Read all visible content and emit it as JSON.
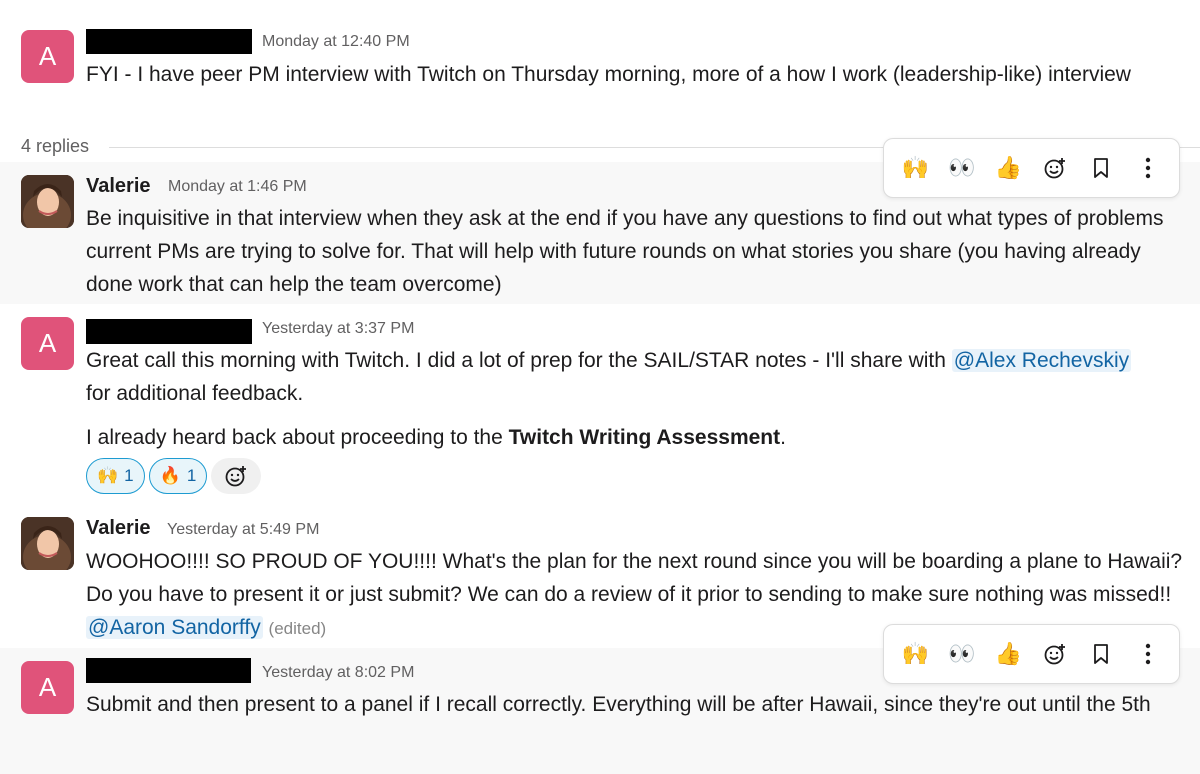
{
  "messages": [
    {
      "avatar_letter": "A",
      "timestamp": "Monday at 12:40 PM",
      "text": "FYI - I have peer PM interview with Twitch on Thursday morning, more of a how I work (leadership-like) interview"
    },
    {
      "author": "Valerie",
      "timestamp": "Monday at 1:46 PM",
      "text": "Be inquisitive in that interview when they ask at the end if you have any questions  to find out what types of problems current PMs are trying to solve for. That will help with future rounds on what stories you share (you having already done work that can help the team overcome)"
    },
    {
      "avatar_letter": "A",
      "timestamp": "Yesterday at 3:37 PM",
      "text_before_mention": "Great call this morning with Twitch. I did a lot of prep for the SAIL/STAR notes - I'll share with ",
      "mention": "@Alex Rechevskiy",
      "text_after_mention": "for additional feedback.",
      "para2_before": "I already heard back about proceeding to the ",
      "para2_bold": "Twitch Writing Assessment",
      "para2_after": ".",
      "reactions": [
        {
          "emoji": "🙌",
          "count": "1"
        },
        {
          "emoji": "🔥",
          "count": "1"
        }
      ]
    },
    {
      "author": "Valerie",
      "timestamp": "Yesterday at 5:49 PM",
      "text_before_mention": "WOOHOO!!!! SO PROUD OF YOU!!!! What's the plan for the next round since you will be boarding a plane to Hawaii? Do you have to present it or just submit? We can do a review of it prior to sending to make sure nothing was missed!! ",
      "mention": "@Aaron Sandorffy",
      "edited": "(edited)"
    },
    {
      "avatar_letter": "A",
      "timestamp": "Yesterday at 8:02 PM",
      "text": "Submit and then present to a panel if I recall correctly. Everything will be after Hawaii, since they're out until the 5th"
    }
  ],
  "thread": {
    "replies_label": "4 replies"
  },
  "toolbar_icons": [
    "raising-hands-icon",
    "eyes-icon",
    "thumbs-up-icon",
    "add-reaction-icon",
    "bookmark-icon",
    "more-actions-icon"
  ],
  "colors": {
    "avatar_bg": "#e0537a",
    "mention": "#1264a3",
    "reaction_border": "#1d9bd1"
  }
}
